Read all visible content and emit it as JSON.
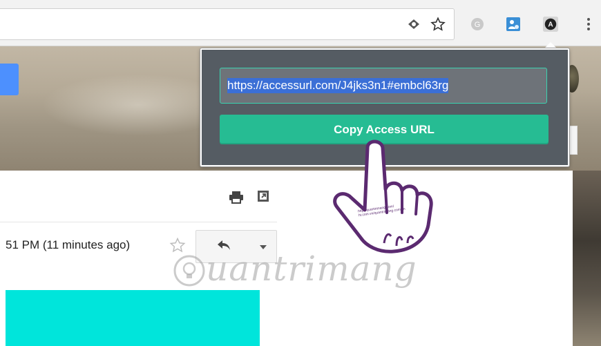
{
  "toolbar": {
    "icons": [
      "lens-icon",
      "bookmark-star-icon",
      "grammarly-icon",
      "contact-card-icon",
      "accessurl-extension-icon",
      "kebab-menu-icon"
    ],
    "extension_letter": "A",
    "grammarly_letter": "G"
  },
  "popup": {
    "url_value": "https://accessurl.com/J4jks3n1#embcl63rg",
    "copy_button_label": "Copy Access URL",
    "accent_color": "#26bc93",
    "bg_color": "#555c63"
  },
  "mail": {
    "timestamp": "51 PM (11 minutes ago)"
  },
  "overlay": {
    "hand_text_line1": "http://quantrimang.com/",
    "hand_text_line2": "ht.com.vn/quantrimang.com.vn",
    "watermark_text": "uantrimang"
  }
}
